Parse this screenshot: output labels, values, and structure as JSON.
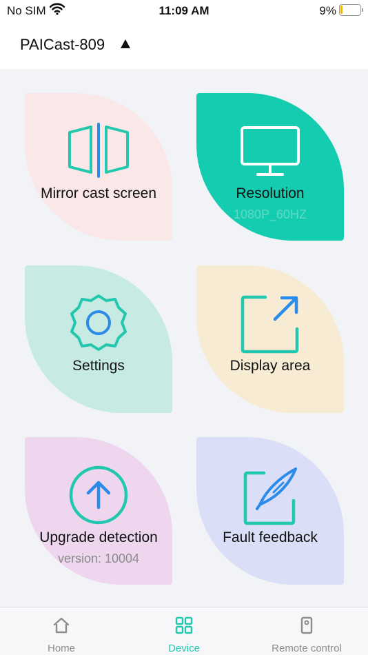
{
  "status_bar": {
    "carrier": "No SIM",
    "time": "11:09 AM",
    "battery": "9%",
    "battery_level_percent": 9
  },
  "header": {
    "device_name": "PAICast-809"
  },
  "tiles": [
    {
      "label": "Mirror cast screen",
      "sub": "",
      "icon": "mirror-screen-icon"
    },
    {
      "label": "Resolution",
      "sub": "1080P_60HZ",
      "icon": "monitor-icon"
    },
    {
      "label": "Settings",
      "sub": "",
      "icon": "gear-icon"
    },
    {
      "label": "Display area",
      "sub": "",
      "icon": "expand-arrow-icon"
    },
    {
      "label": "Upgrade detection",
      "sub": "version: 10004",
      "icon": "upload-arrow-icon"
    },
    {
      "label": "Fault feedback",
      "sub": "",
      "icon": "feather-pen-icon"
    }
  ],
  "tab_bar": {
    "tabs": [
      {
        "label": "Home",
        "icon": "home-icon",
        "active": false
      },
      {
        "label": "Device",
        "icon": "grid-icon",
        "active": true
      },
      {
        "label": "Remote control",
        "icon": "remote-icon",
        "active": false
      }
    ]
  },
  "colors": {
    "accent": "#22c8ad",
    "icon_blue": "#2b8bea",
    "resolution_tile": "#14cdb0"
  }
}
